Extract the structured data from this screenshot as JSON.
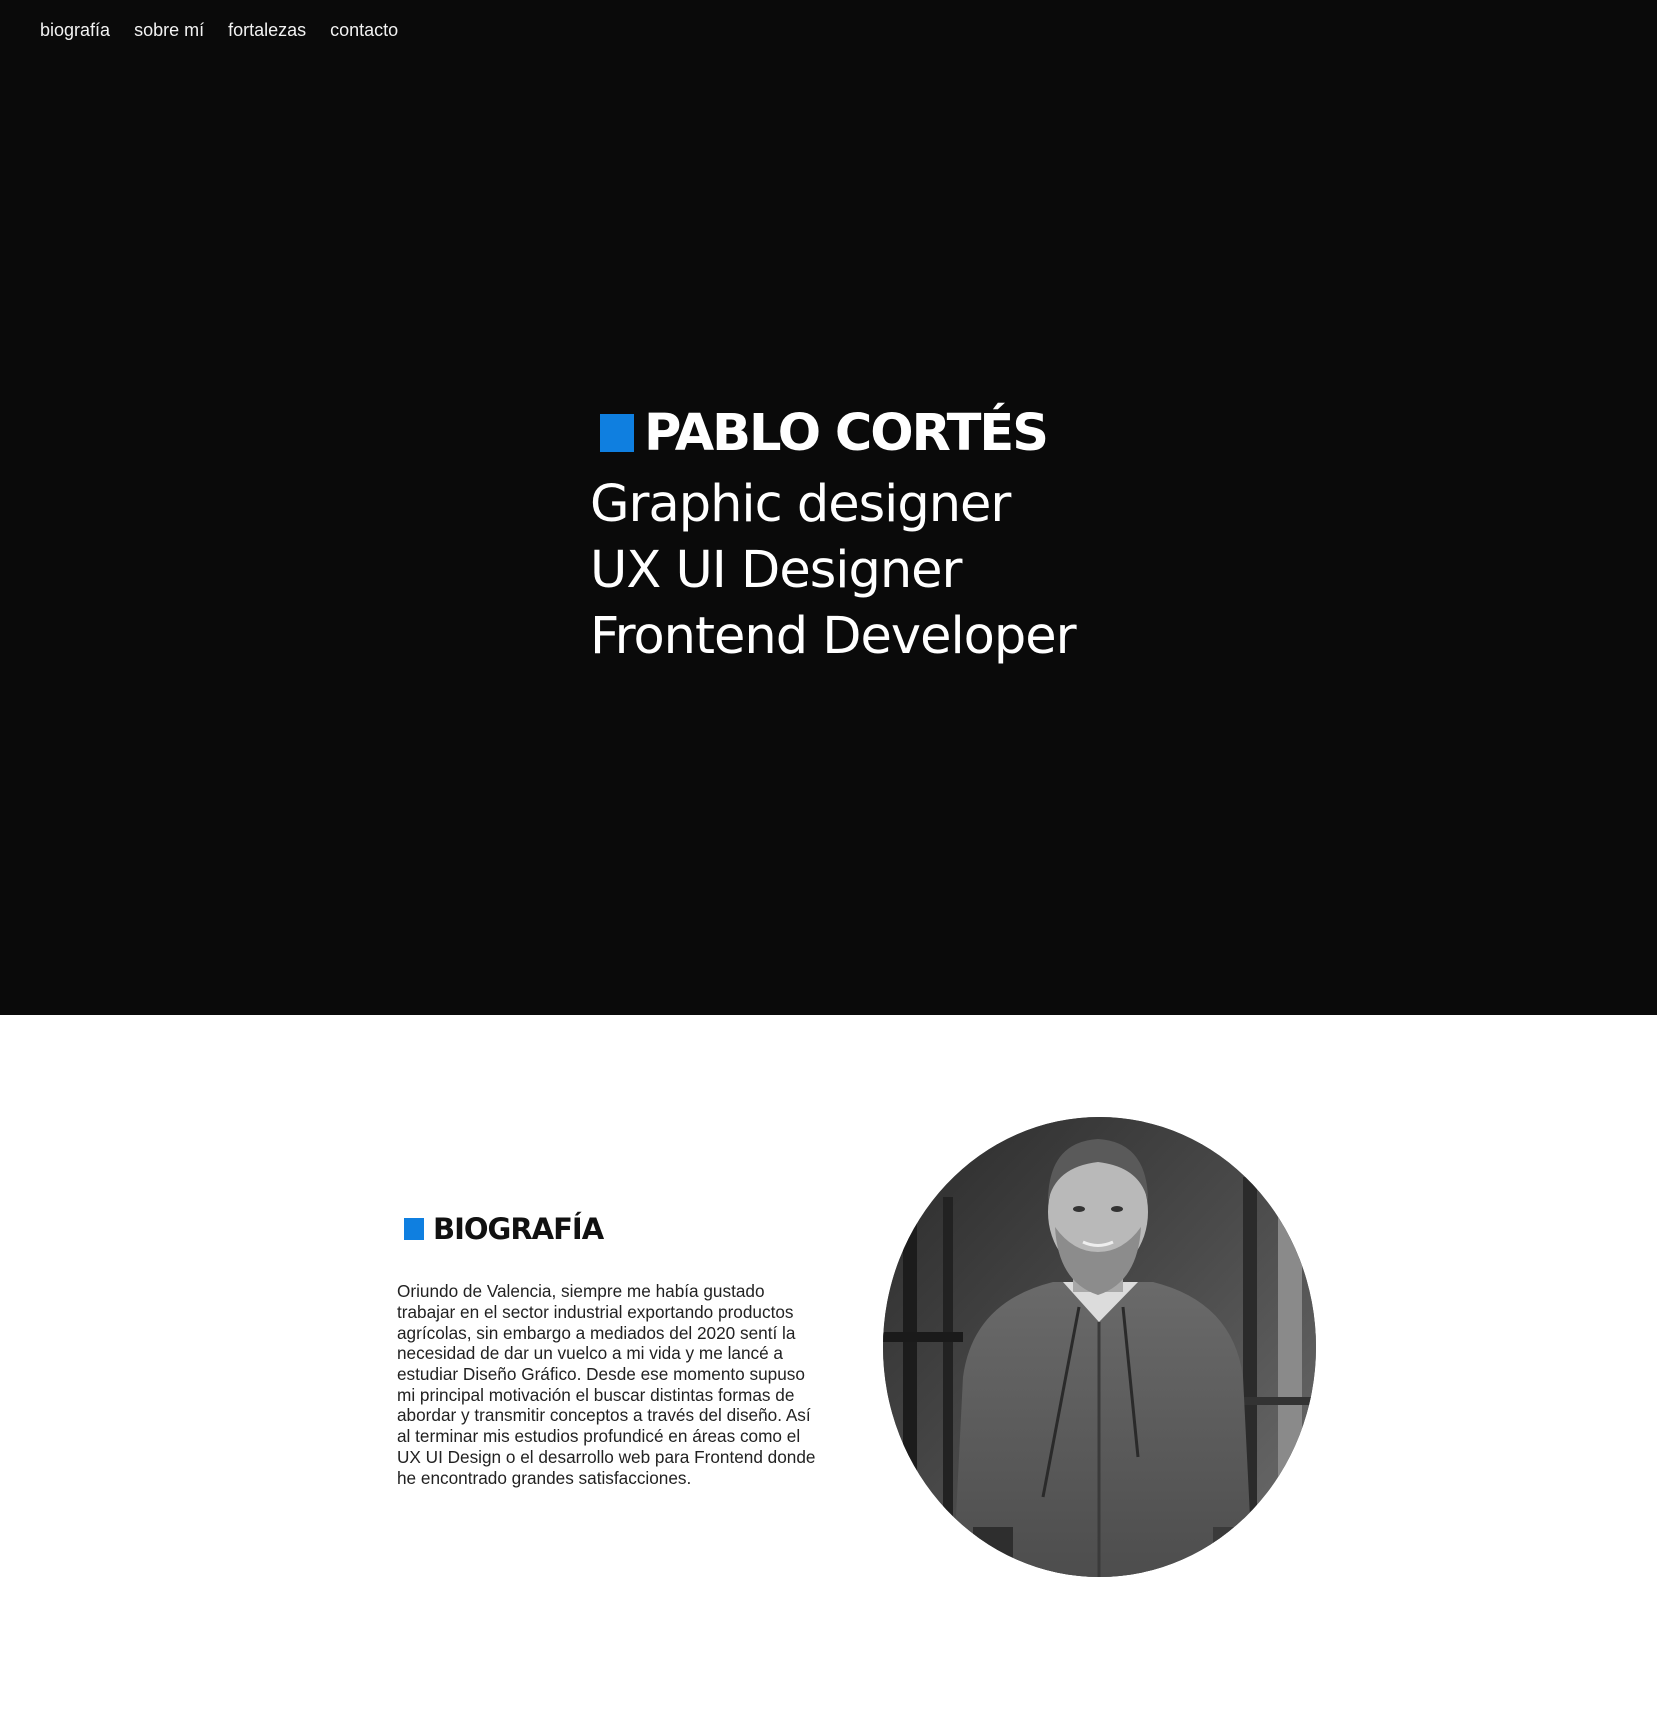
{
  "nav": {
    "items": [
      {
        "label": "biografía"
      },
      {
        "label": "sobre mí"
      },
      {
        "label": "fortalezas"
      },
      {
        "label": "contacto"
      }
    ]
  },
  "hero": {
    "name": "PABLO CORTÉS",
    "roles": [
      "Graphic designer",
      "UX UI Designer",
      "Frontend Developer"
    ],
    "accent_color": "#0f7fe0",
    "background_color": "#0a0a0a"
  },
  "biography": {
    "title": "BIOGRAFÍA",
    "text": "Oriundo de Valencia, siempre me había gustado trabajar en el sector industrial exportando productos agrícolas, sin embargo a mediados del 2020 sentí la necesidad de dar un vuelco a mi vida y me lancé a estudiar Diseño Gráfico. Desde ese momento supuso mi principal motivación el buscar distintas formas de abordar y transmitir conceptos a través del diseño. Así al terminar mis estudios profundicé en áreas como el UX UI Design o el desarrollo web para Frontend donde he encontrado grandes satisfacciones.",
    "photo": "portrait-photo"
  }
}
